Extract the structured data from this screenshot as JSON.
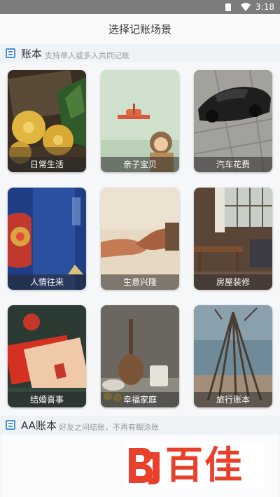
{
  "status_bar": {
    "time": "3:18"
  },
  "title": "选择记账场景",
  "sections": {
    "books": {
      "title": "账本",
      "subtitle": "支持单人或多人共同记账"
    },
    "aa": {
      "title": "AA账本",
      "subtitle": "好友之间结账，不再有糊涂账"
    }
  },
  "scenes": [
    {
      "label": "日常生活",
      "icon": "pineapple-image"
    },
    {
      "label": "亲子宝贝",
      "icon": "toy-plane-child-image"
    },
    {
      "label": "汽车花费",
      "icon": "sports-car-image"
    },
    {
      "label": "人情往来",
      "icon": "red-envelope-image"
    },
    {
      "label": "生意兴隆",
      "icon": "handshake-image"
    },
    {
      "label": "房屋装修",
      "icon": "living-room-image"
    },
    {
      "label": "结婚喜事",
      "icon": "wedding-envelope-image"
    },
    {
      "label": "幸福家庭",
      "icon": "kitchenware-image"
    },
    {
      "label": "旅行账本",
      "icon": "driftwood-beach-image"
    }
  ],
  "watermark": {
    "text": "百佳"
  },
  "colors": {
    "accent": "#4a90d9",
    "watermark_red": "#e8402a"
  }
}
